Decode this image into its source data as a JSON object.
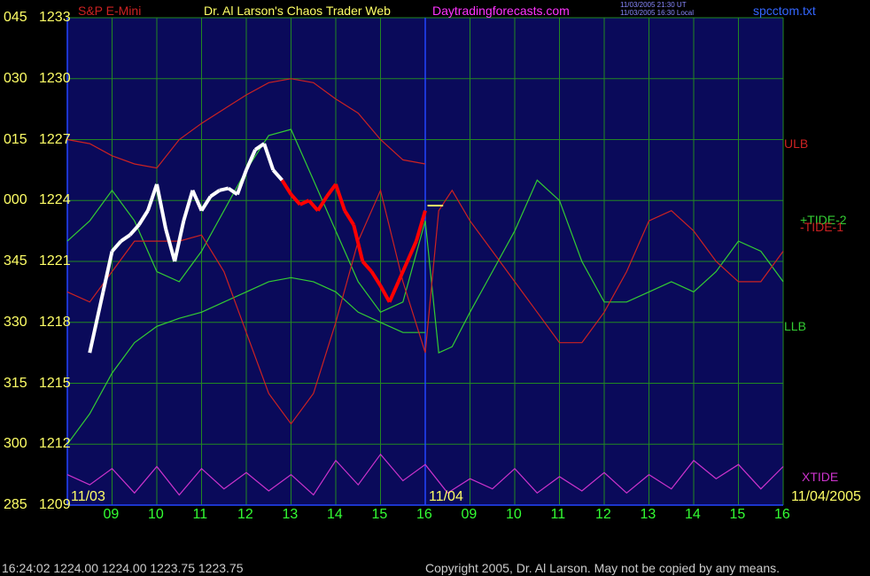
{
  "header": {
    "instrument": "S&P E-Mini",
    "title": "Dr. Al Larson's Chaos Trader Web",
    "site": "Daytradingforecasts.com",
    "time_ut": "11/03/2005 21:30 UT",
    "time_local": "11/03/2005 16:30 Local",
    "file": "spcctom.txt"
  },
  "colors": {
    "plot_bg": "#0a0a5a",
    "grid": "#228822",
    "price_up": "#ffffff",
    "price_down": "#ff0000",
    "ulb": "#cc2222",
    "llb": "#33cc33",
    "tide_plus": "#33cc33",
    "tide_minus": "#cc2222",
    "xtide": "#cc33cc",
    "blue": "#2244ff",
    "yellow": "#ffff66",
    "cyan_text": "#3366ff"
  },
  "series_labels": {
    "ulb": "ULB",
    "llb": "LLB",
    "tide_plus": "+TIDE-2",
    "tide_minus": "-TIDE-1",
    "xtide": "XTIDE"
  },
  "date_labels": {
    "start": "11/03",
    "mid": "11/04",
    "end": "11/04/2005"
  },
  "footer": {
    "quote": "16:24:02  1224.00 1224.00 1223.75 1223.75",
    "copyright": "Copyright 2005, Dr. Al Larson. May not be copied by any means."
  },
  "chart_data": {
    "type": "line",
    "y_axis_labels": [
      {
        "code": "045",
        "price": "1233"
      },
      {
        "code": "030",
        "price": "1230"
      },
      {
        "code": "015",
        "price": "1227"
      },
      {
        "code": "000",
        "price": "1224"
      },
      {
        "code": "345",
        "price": "1221"
      },
      {
        "code": "330",
        "price": "1218"
      },
      {
        "code": "315",
        "price": "1215"
      },
      {
        "code": "300",
        "price": "1212"
      },
      {
        "code": "285",
        "price": "1209"
      }
    ],
    "ylim": [
      1209,
      1233
    ],
    "x_tick_labels": [
      "09",
      "10",
      "11",
      "12",
      "13",
      "14",
      "15",
      "16",
      "09",
      "10",
      "11",
      "12",
      "13",
      "14",
      "15",
      "16"
    ],
    "price_series": {
      "name": "S&P E-Mini",
      "x": [
        8.5,
        8.8,
        9.0,
        9.2,
        9.4,
        9.6,
        9.8,
        10.0,
        10.2,
        10.4,
        10.6,
        10.8,
        11.0,
        11.2,
        11.4,
        11.6,
        11.8,
        12.0,
        12.2,
        12.4,
        12.6,
        12.8,
        13.0,
        13.2,
        13.4,
        13.6,
        13.8,
        14.0,
        14.2,
        14.4,
        14.6,
        14.8,
        15.0,
        15.2,
        15.4,
        15.6,
        15.8,
        16.0
      ],
      "y": [
        1216.5,
        1219.5,
        1221.5,
        1222.0,
        1222.3,
        1222.8,
        1223.5,
        1224.8,
        1222.6,
        1221.0,
        1223.0,
        1224.5,
        1223.5,
        1224.2,
        1224.5,
        1224.6,
        1224.3,
        1225.5,
        1226.5,
        1226.8,
        1225.5,
        1225.0,
        1224.3,
        1223.8,
        1224.0,
        1223.5,
        1224.2,
        1224.8,
        1223.5,
        1222.8,
        1221.0,
        1220.5,
        1219.8,
        1219.0,
        1220.0,
        1221.0,
        1222.0,
        1223.5
      ],
      "down_segment_x": [
        12.9,
        16.0
      ]
    },
    "series": [
      {
        "name": "ULB",
        "x": [
          8.0,
          8.5,
          9.0,
          9.5,
          10.0,
          10.5,
          11.0,
          11.5,
          12.0,
          12.5,
          13.0,
          13.5,
          14.0,
          14.5,
          15.0,
          15.5,
          16.0
        ],
        "y": [
          1227.0,
          1226.8,
          1226.2,
          1225.8,
          1225.6,
          1227.0,
          1227.8,
          1228.5,
          1229.2,
          1229.8,
          1230.0,
          1229.8,
          1229.0,
          1228.3,
          1227.0,
          1226.0,
          1225.8
        ]
      },
      {
        "name": "LLB",
        "x": [
          8.0,
          8.5,
          9.0,
          9.5,
          10.0,
          10.5,
          11.0,
          11.5,
          12.0,
          12.5,
          13.0,
          13.5,
          14.0,
          14.5,
          15.0,
          15.5,
          16.0
        ],
        "y": [
          1212.0,
          1213.5,
          1215.5,
          1217.0,
          1217.8,
          1218.2,
          1218.5,
          1219.0,
          1219.5,
          1220.0,
          1220.2,
          1220.0,
          1219.5,
          1218.5,
          1218.0,
          1217.5,
          1217.5
        ]
      },
      {
        "name": "+TIDE-2",
        "x": [
          8.0,
          8.5,
          9.0,
          9.5,
          10.0,
          10.5,
          11.0,
          11.5,
          12.0,
          12.5,
          13.0,
          13.5,
          14.0,
          14.5,
          15.0,
          15.5,
          16.0,
          16.3,
          16.6,
          17.0,
          17.5,
          18.0,
          18.5,
          19.0,
          19.5,
          20.0,
          20.5,
          21.0,
          21.5,
          22.0,
          22.5,
          23.0,
          23.5,
          24.0
        ],
        "y": [
          1222.0,
          1223.0,
          1224.5,
          1223.0,
          1220.5,
          1220.0,
          1221.5,
          1223.5,
          1225.5,
          1227.2,
          1227.5,
          1225.0,
          1222.5,
          1220.0,
          1218.5,
          1219.0,
          1223.0,
          1216.5,
          1216.8,
          1218.5,
          1220.5,
          1222.5,
          1225.0,
          1224.0,
          1221.0,
          1219.0,
          1219.0,
          1219.5,
          1220.0,
          1219.5,
          1220.5,
          1222.0,
          1221.5,
          1220.0
        ]
      },
      {
        "name": "-TIDE-1",
        "x": [
          8.0,
          8.5,
          9.0,
          9.5,
          10.0,
          10.5,
          11.0,
          11.5,
          12.0,
          12.5,
          13.0,
          13.5,
          14.0,
          14.5,
          15.0,
          15.5,
          16.0,
          16.3,
          16.6,
          17.0,
          17.5,
          18.0,
          18.5,
          19.0,
          19.5,
          20.0,
          20.5,
          21.0,
          21.5,
          22.0,
          22.5,
          23.0,
          23.5,
          24.0
        ],
        "y": [
          1219.5,
          1219.0,
          1220.5,
          1222.0,
          1222.0,
          1222.0,
          1222.3,
          1220.5,
          1217.5,
          1214.5,
          1213.0,
          1214.5,
          1218.0,
          1222.0,
          1224.5,
          1220.0,
          1216.5,
          1223.5,
          1224.5,
          1223.0,
          1221.5,
          1220.0,
          1218.5,
          1217.0,
          1217.0,
          1218.5,
          1220.5,
          1223.0,
          1223.5,
          1222.5,
          1221.0,
          1220.0,
          1220.0,
          1221.5
        ]
      },
      {
        "name": "XTIDE",
        "x": [
          8.0,
          8.5,
          9.0,
          9.5,
          10.0,
          10.5,
          11.0,
          11.5,
          12.0,
          12.5,
          13.0,
          13.5,
          14.0,
          14.5,
          15.0,
          15.5,
          16.0,
          16.5,
          17.0,
          17.5,
          18.0,
          18.5,
          19.0,
          19.5,
          20.0,
          20.5,
          21.0,
          21.5,
          22.0,
          22.5,
          23.0,
          23.5,
          24.0
        ],
        "y": [
          1210.5,
          1210.0,
          1210.8,
          1209.6,
          1210.9,
          1209.5,
          1210.8,
          1209.8,
          1210.6,
          1209.7,
          1210.5,
          1209.5,
          1211.2,
          1210.0,
          1211.5,
          1210.2,
          1211.0,
          1209.6,
          1210.3,
          1209.8,
          1210.8,
          1209.6,
          1210.4,
          1209.7,
          1210.6,
          1209.6,
          1210.5,
          1209.8,
          1211.2,
          1210.3,
          1211.0,
          1209.8,
          1210.9
        ]
      }
    ],
    "grid": true
  }
}
